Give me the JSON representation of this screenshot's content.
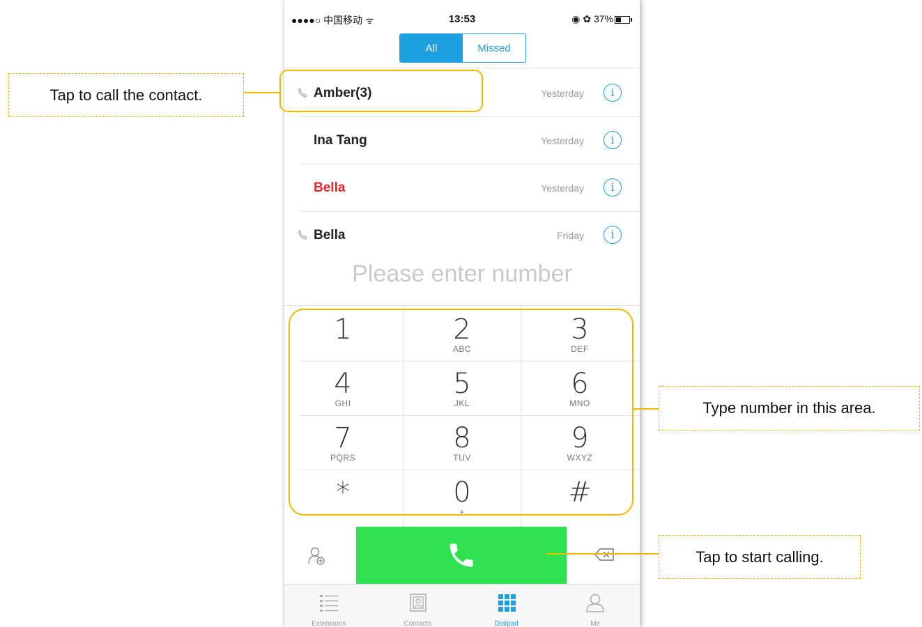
{
  "status": {
    "carrier": "●●●●○ 中国移动 ᯤ",
    "time": "13:53",
    "right": "◉ ✿ 37%"
  },
  "segment": {
    "all": "All",
    "missed": "Missed"
  },
  "calls": [
    {
      "name": "Amber(3)",
      "date": "Yesterday",
      "color": "#222222",
      "outgoing": true
    },
    {
      "name": "Ina Tang",
      "date": "Yesterday",
      "color": "#222222",
      "outgoing": false
    },
    {
      "name": "Bella",
      "date": "Yesterday",
      "color": "#e8252e",
      "outgoing": false
    },
    {
      "name": "Bella",
      "date": "Friday",
      "color": "#222222",
      "outgoing": true
    }
  ],
  "number_placeholder": "Please enter number",
  "keys": [
    {
      "digit": "1",
      "letters": ""
    },
    {
      "digit": "2",
      "letters": "ABC"
    },
    {
      "digit": "3",
      "letters": "DEF"
    },
    {
      "digit": "4",
      "letters": "GHI"
    },
    {
      "digit": "5",
      "letters": "JKL"
    },
    {
      "digit": "6",
      "letters": "MNO"
    },
    {
      "digit": "7",
      "letters": "PQRS"
    },
    {
      "digit": "8",
      "letters": "TUV"
    },
    {
      "digit": "9",
      "letters": "WXYZ"
    },
    {
      "digit": "*",
      "letters": ""
    },
    {
      "digit": "0",
      "letters": "+"
    },
    {
      "digit": "#",
      "letters": ""
    }
  ],
  "tabs": [
    {
      "label": "Extensions",
      "icon": "list-icon"
    },
    {
      "label": "Contacts",
      "icon": "contacts-book-icon"
    },
    {
      "label": "Dialpad",
      "icon": "dialpad-grid-icon",
      "active": true
    },
    {
      "label": "Me",
      "icon": "person-icon"
    }
  ],
  "annotations": {
    "call_contact": "Tap to call the contact.",
    "type_number": "Type number in this area.",
    "start_calling": "Tap to start calling."
  },
  "colors": {
    "accent": "#1da0df",
    "call_green": "#2ee14f",
    "highlight": "#f5b800",
    "missed_red": "#e8252e"
  }
}
